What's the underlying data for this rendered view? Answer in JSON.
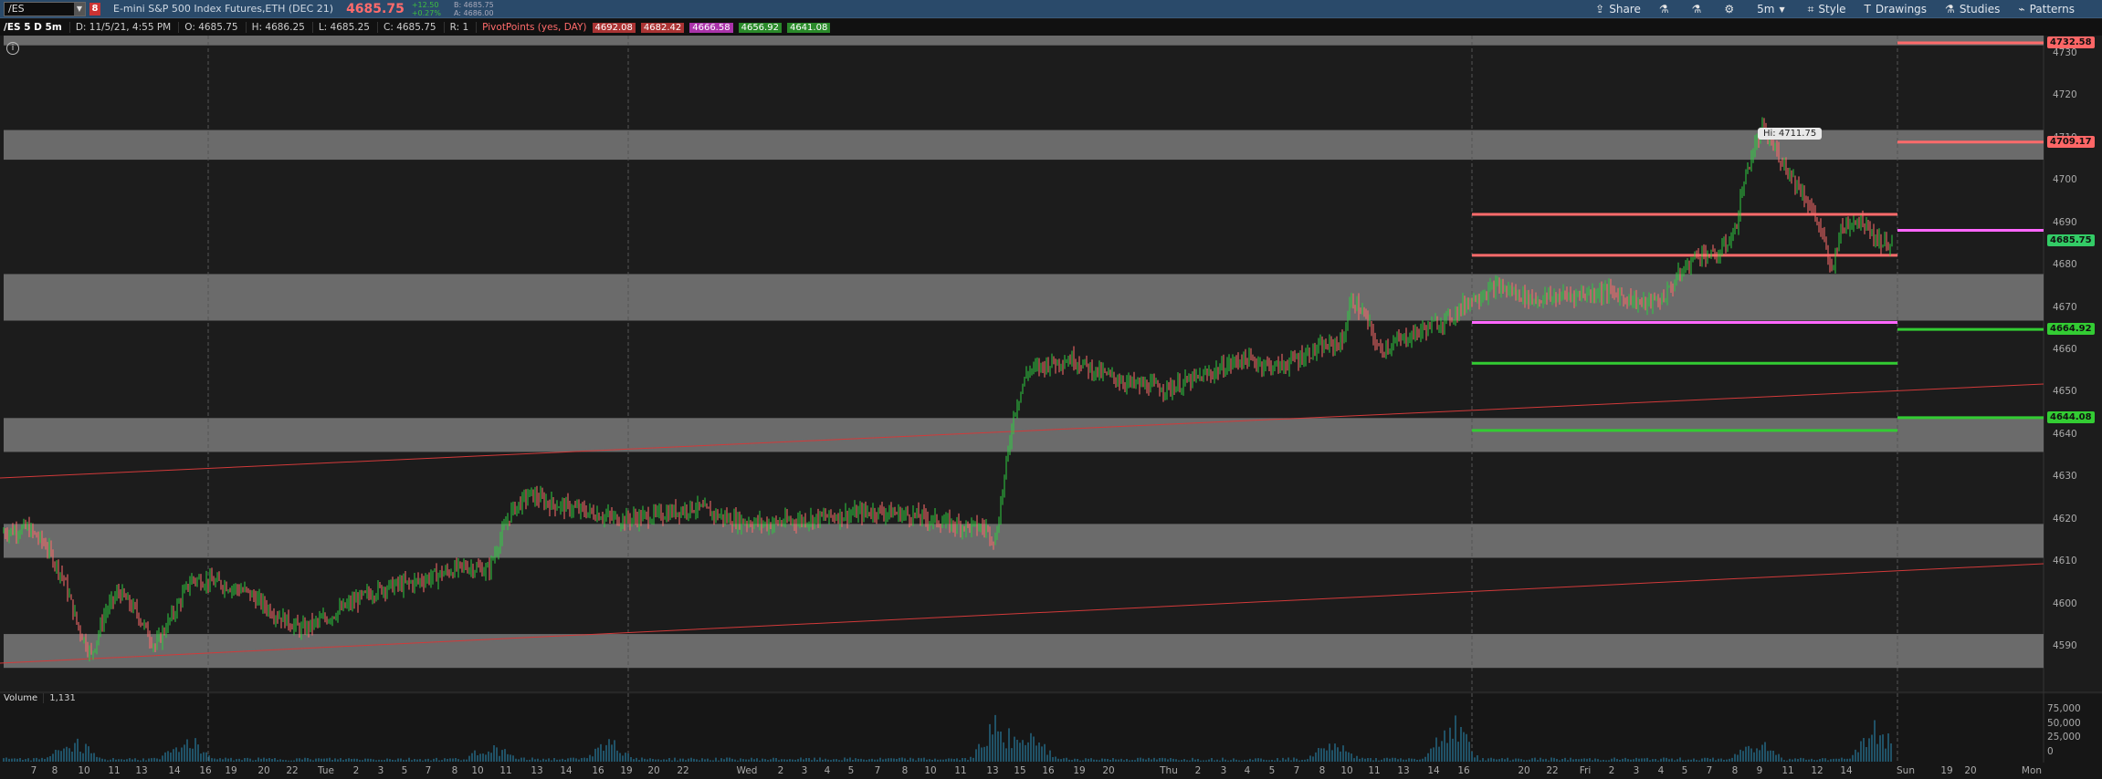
{
  "topbar": {
    "symbol": "/ES",
    "alert_badge": "8",
    "instrument": "E-mini S&P 500 Index Futures,ETH (DEC 21)",
    "last_price": "4685.75",
    "change_abs": "+12.50",
    "change_pct": "+0.27%",
    "bid": "B: 4685.75",
    "ask": "A: 4686.00",
    "buttons": {
      "share": "Share",
      "timeframe": "5m",
      "style": "Style",
      "drawings": "Drawings",
      "studies": "Studies",
      "patterns": "Patterns"
    }
  },
  "chart_header": {
    "title": "/ES 5 D 5m",
    "date": "D: 11/5/21, 4:55 PM",
    "open": "O: 4685.75",
    "high": "H: 4686.25",
    "low": "L: 4685.25",
    "close": "C: 4685.75",
    "range": "R: 1",
    "pivot_label": "PivotPoints (yes, DAY)",
    "pivot_values": [
      {
        "text": "4692.08",
        "color": "#ff6b6b"
      },
      {
        "text": "4682.42",
        "color": "#ff6b6b"
      },
      {
        "text": "4666.58",
        "color": "#ff66ff"
      },
      {
        "text": "4656.92",
        "color": "#33cc33"
      },
      {
        "text": "4641.08",
        "color": "#33cc33"
      }
    ]
  },
  "info_icon": "i",
  "hi_label": "Hi: 4711.75",
  "price_axis": {
    "ticks": [
      "4730",
      "4720",
      "4710",
      "4700",
      "4690",
      "4680",
      "4670",
      "4660",
      "4650",
      "4640",
      "4630",
      "4620",
      "4610",
      "4600",
      "4590"
    ]
  },
  "price_tags": [
    {
      "text": "4732.58",
      "color": "#ff6666"
    },
    {
      "text": "4709.17",
      "color": "#ff6666"
    },
    {
      "text": "4685.75",
      "color": "#33cc66"
    },
    {
      "text": "4664.92",
      "color": "#33cc33"
    },
    {
      "text": "4644.08",
      "color": "#33cc33"
    }
  ],
  "volume": {
    "label": "Volume",
    "value": "1,131",
    "ticks": [
      "75,000",
      "50,000",
      "25,000",
      "0"
    ]
  },
  "x_axis": {
    "labels": [
      "7",
      "8",
      "10",
      "11",
      "13",
      "14",
      "16",
      "19",
      "20",
      "22",
      "Tue",
      "2",
      "3",
      "5",
      "7",
      "8",
      "10",
      "11",
      "13",
      "14",
      "16",
      "19",
      "20",
      "22",
      "Wed",
      "2",
      "3",
      "4",
      "5",
      "7",
      "8",
      "10",
      "11",
      "13",
      "15",
      "16",
      "19",
      "20",
      "Thu",
      "2",
      "3",
      "4",
      "5",
      "7",
      "8",
      "10",
      "11",
      "13",
      "14",
      "16",
      "20",
      "22",
      "Fri",
      "2",
      "3",
      "4",
      "5",
      "7",
      "8",
      "9",
      "11",
      "12",
      "14",
      "Sun",
      "19",
      "20",
      "Mon"
    ]
  },
  "chart_data": {
    "type": "candlestick",
    "title": "/ES 5 D 5m",
    "y_range": [
      4585,
      4736
    ],
    "high": 4711.75,
    "last": 4685.75,
    "pivot_lines_fri": [
      {
        "value": 4692.08,
        "color": "#ff6b6b"
      },
      {
        "value": 4682.42,
        "color": "#ff6b6b"
      },
      {
        "value": 4666.58,
        "color": "#ff66ff"
      },
      {
        "value": 4656.92,
        "color": "#33cc33"
      },
      {
        "value": 4641.08,
        "color": "#33cc33"
      }
    ],
    "pivot_lines_next": [
      {
        "value": 4732.58,
        "color": "#ff6b6b"
      },
      {
        "value": 4709.17,
        "color": "#ff6b6b"
      },
      {
        "value": 4688.33,
        "color": "#ff66ff"
      },
      {
        "value": 4664.92,
        "color": "#33cc33"
      },
      {
        "value": 4644.08,
        "color": "#33cc33"
      }
    ],
    "gray_zones": [
      [
        4732,
        4737
      ],
      [
        4705,
        4712
      ],
      [
        4667,
        4678
      ],
      [
        4636,
        4644
      ],
      [
        4611,
        4619
      ],
      [
        4585,
        4593
      ]
    ],
    "price_path": [
      [
        0,
        4617
      ],
      [
        30,
        4618
      ],
      [
        50,
        4614
      ],
      [
        70,
        4606
      ],
      [
        85,
        4595
      ],
      [
        100,
        4588
      ],
      [
        115,
        4598
      ],
      [
        130,
        4603
      ],
      [
        150,
        4598
      ],
      [
        170,
        4590
      ],
      [
        190,
        4598
      ],
      [
        210,
        4606
      ],
      [
        240,
        4605
      ],
      [
        270,
        4603
      ],
      [
        300,
        4598
      ],
      [
        330,
        4594
      ],
      [
        360,
        4597
      ],
      [
        390,
        4601
      ],
      [
        420,
        4604
      ],
      [
        450,
        4605
      ],
      [
        480,
        4607
      ],
      [
        510,
        4609
      ],
      [
        535,
        4608
      ],
      [
        545,
        4614
      ],
      [
        560,
        4622
      ],
      [
        580,
        4626
      ],
      [
        600,
        4624
      ],
      [
        640,
        4622
      ],
      [
        680,
        4620
      ],
      [
        720,
        4621
      ],
      [
        760,
        4623
      ],
      [
        800,
        4620
      ],
      [
        840,
        4619
      ],
      [
        880,
        4620
      ],
      [
        920,
        4621
      ],
      [
        960,
        4622
      ],
      [
        1000,
        4621
      ],
      [
        1040,
        4619
      ],
      [
        1080,
        4618
      ],
      [
        1090,
        4615
      ],
      [
        1100,
        4630
      ],
      [
        1110,
        4645
      ],
      [
        1125,
        4655
      ],
      [
        1150,
        4657
      ],
      [
        1175,
        4658
      ],
      [
        1200,
        4655
      ],
      [
        1240,
        4652
      ],
      [
        1280,
        4651
      ],
      [
        1320,
        4654
      ],
      [
        1360,
        4658
      ],
      [
        1400,
        4656
      ],
      [
        1440,
        4660
      ],
      [
        1470,
        4662
      ],
      [
        1480,
        4672
      ],
      [
        1495,
        4668
      ],
      [
        1510,
        4660
      ],
      [
        1540,
        4663
      ],
      [
        1570,
        4666
      ],
      [
        1590,
        4668
      ],
      [
        1610,
        4672
      ],
      [
        1640,
        4675
      ],
      [
        1680,
        4672
      ],
      [
        1720,
        4673
      ],
      [
        1760,
        4674
      ],
      [
        1800,
        4671
      ],
      [
        1820,
        4672
      ],
      [
        1840,
        4678
      ],
      [
        1860,
        4683
      ],
      [
        1880,
        4682
      ],
      [
        1900,
        4688
      ],
      [
        1910,
        4700
      ],
      [
        1920,
        4707
      ],
      [
        1930,
        4712
      ],
      [
        1945,
        4707
      ],
      [
        1960,
        4702
      ],
      [
        1980,
        4695
      ],
      [
        1995,
        4688
      ],
      [
        2005,
        4678
      ],
      [
        2015,
        4688
      ],
      [
        2030,
        4691
      ],
      [
        2045,
        4690
      ],
      [
        2055,
        4686
      ],
      [
        2070,
        4685
      ]
    ],
    "volume_spikes": [
      [
        80,
        35000
      ],
      [
        205,
        38000
      ],
      [
        538,
        25000
      ],
      [
        668,
        30000
      ],
      [
        1092,
        65000
      ],
      [
        1129,
        40000
      ],
      [
        1460,
        30000
      ],
      [
        1590,
        74000
      ],
      [
        1925,
        35000
      ],
      [
        2055,
        60000
      ]
    ]
  }
}
